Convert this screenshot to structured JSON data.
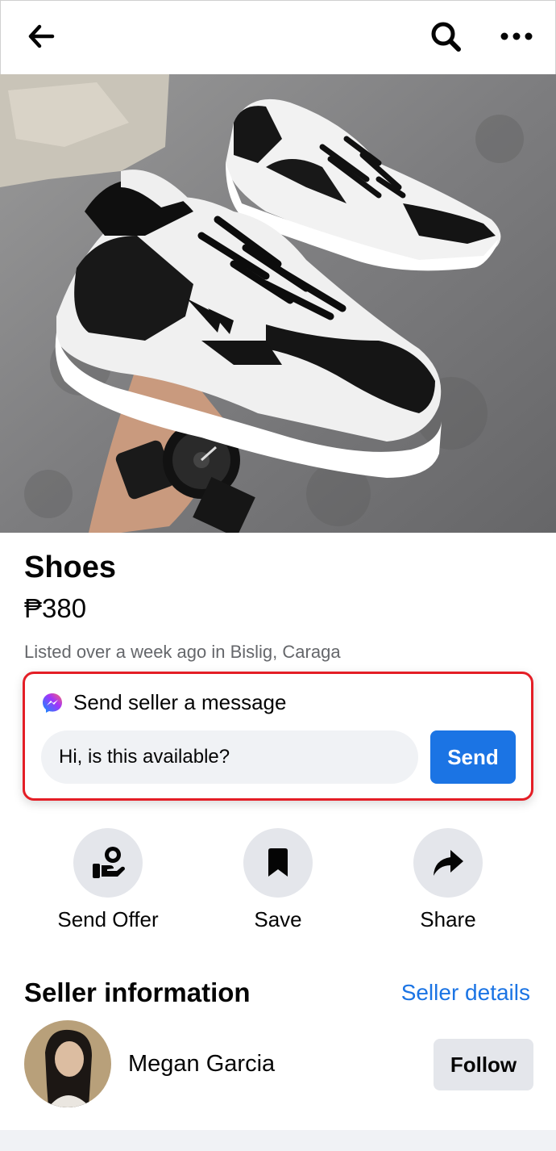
{
  "header": {
    "back_icon": "arrow-left-icon",
    "search_icon": "search-icon",
    "more_icon": "more-horizontal-icon"
  },
  "listing": {
    "photo": "sneaker-product-photo",
    "title": "Shoes",
    "price": "₱380",
    "listed_text": "Listed over a week ago in Bislig, Caraga"
  },
  "message": {
    "icon": "messenger-icon",
    "heading": "Send seller a message",
    "input_value": "Hi, is this available?",
    "send_label": "Send",
    "highlight_color": "#e41e26"
  },
  "actions": [
    {
      "label": "Send Offer",
      "icon": "send-offer-icon"
    },
    {
      "label": "Save",
      "icon": "bookmark-icon"
    },
    {
      "label": "Share",
      "icon": "share-icon"
    }
  ],
  "seller": {
    "heading": "Seller information",
    "details_link": "Seller details",
    "name": "Megan Garcia",
    "follow_label": "Follow"
  },
  "colors": {
    "accent": "#1b74e4",
    "button_grey": "#e4e6eb",
    "secondary_text": "#65676b"
  }
}
